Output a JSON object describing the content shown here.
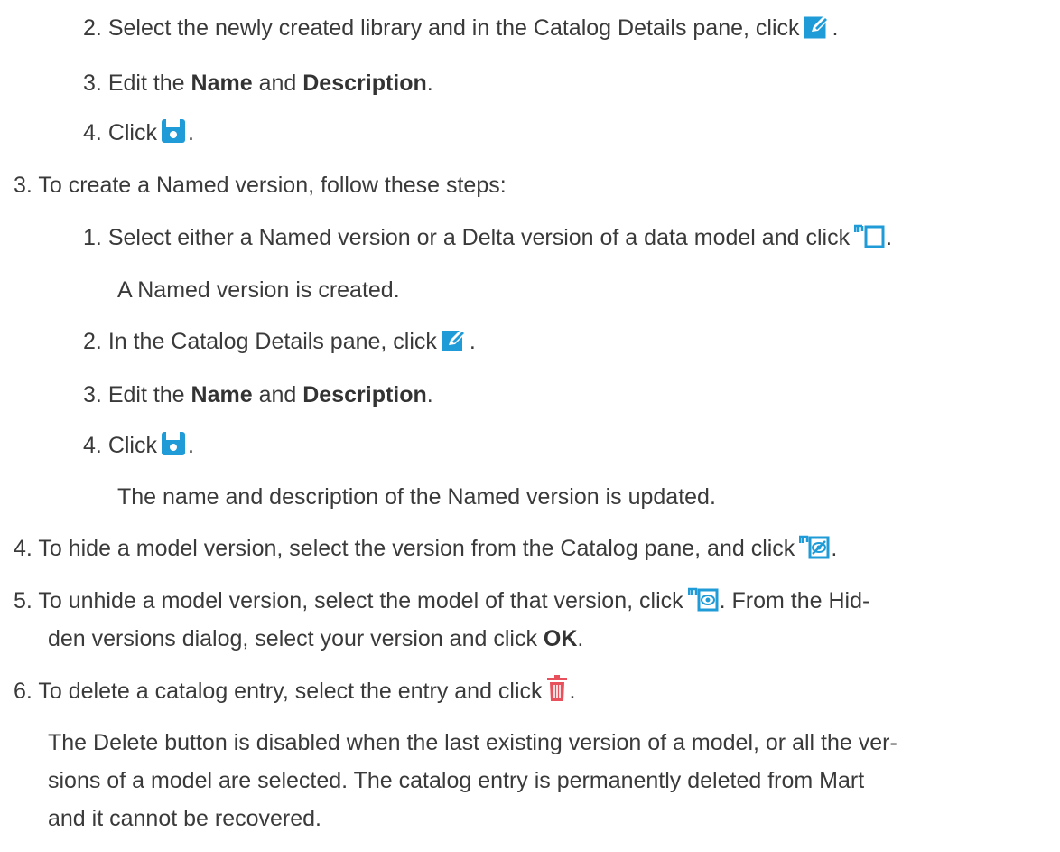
{
  "steps": {
    "s2_2": {
      "num": "2.",
      "text": "Select the newly created library and in the Catalog Details pane, click",
      "after": "."
    },
    "s2_3": {
      "num": "3.",
      "pre": "Edit the ",
      "b1": "Name",
      "mid": " and ",
      "b2": "Description",
      "after": "."
    },
    "s2_4": {
      "num": "4.",
      "pre": "Click",
      "after": "."
    },
    "s3": {
      "num": "3.",
      "text": "To create a Named version, follow these steps:"
    },
    "s3_1": {
      "num": "1.",
      "text": "Select either a Named version or a Delta version of a data model and click",
      "after": "."
    },
    "s3_1_result": "A Named version is created.",
    "s3_2": {
      "num": "2.",
      "text": "In the Catalog Details pane, click",
      "after": "."
    },
    "s3_3": {
      "num": "3.",
      "pre": "Edit the ",
      "b1": "Name",
      "mid": " and ",
      "b2": "Description",
      "after": "."
    },
    "s3_4": {
      "num": "4.",
      "pre": "Click",
      "after": "."
    },
    "s3_4_result": "The name and description of the Named version is updated.",
    "s4": {
      "num": "4.",
      "text": "To hide a model version, select the version from the Catalog pane, and click",
      "after": "."
    },
    "s5": {
      "num": "5.",
      "text": "To unhide a model version, select the model of that version, click",
      "after": ". From the Hid-",
      "line2_pre": "den versions dialog, select your version and click ",
      "line2_b": "OK",
      "line2_after": "."
    },
    "s6": {
      "num": "6.",
      "text": "To delete a catalog entry, select the entry and click",
      "after": "."
    },
    "s6_note": {
      "line1": "The Delete button is disabled when the last existing version of a model, or all the ver-",
      "line2": "sions of a model are selected. The catalog entry is permanently deleted from Mart",
      "line3": "and it cannot be recovered."
    }
  },
  "icons": {
    "edit": "edit-icon",
    "save": "save-icon",
    "create_named_version": "create-named-version-icon",
    "hide_version": "hide-version-icon",
    "unhide_version": "unhide-version-icon",
    "delete": "delete-icon"
  },
  "colors": {
    "icon_blue": "#1f9bd7",
    "delete_red": "#e8505b",
    "text": "#3a3a3a"
  }
}
